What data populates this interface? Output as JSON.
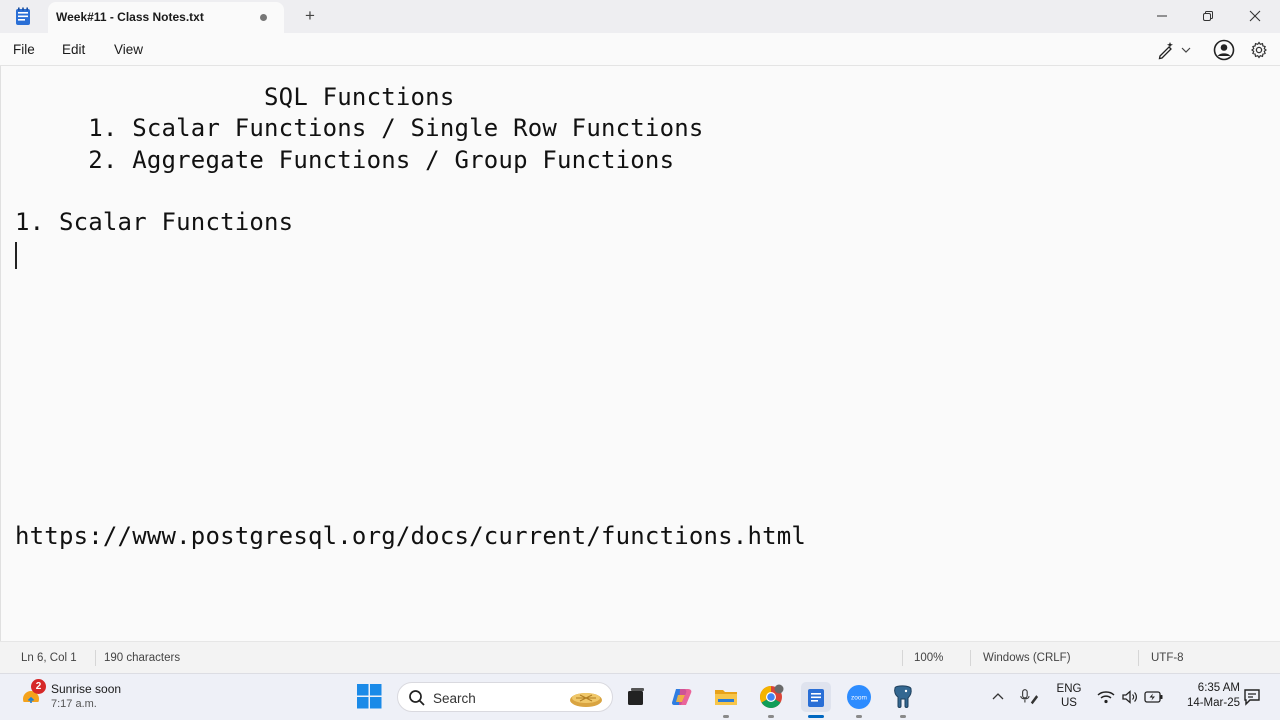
{
  "window": {
    "tab_title": "Week#11 - Class Notes.txt",
    "new_tab": "+"
  },
  "menu": {
    "file": "File",
    "edit": "Edit",
    "view": "View"
  },
  "editor": {
    "lines": [
      "                 SQL Functions",
      "     1. Scalar Functions / Single Row Functions",
      "     2. Aggregate Functions / Group Functions",
      "",
      "1. Scalar Functions",
      "",
      "https://www.postgresql.org/docs/current/functions.html"
    ]
  },
  "status": {
    "position": "Ln 6, Col 1",
    "characters": "190 characters",
    "zoom": "100%",
    "line_ending": "Windows (CRLF)",
    "encoding": "UTF-8"
  },
  "taskbar": {
    "weather_badge": "2",
    "weather_title": "Sunrise soon",
    "weather_sub": "7:17 a.m.",
    "search_placeholder": "Search",
    "lang_line1": "ENG",
    "lang_line2": "US",
    "time": "6:35 AM",
    "date": "14-Mar-25",
    "zoom_app_label": "zoom"
  },
  "colors": {
    "accent_blue": "#0067c0",
    "notepad_blue": "#2a6fd6"
  }
}
